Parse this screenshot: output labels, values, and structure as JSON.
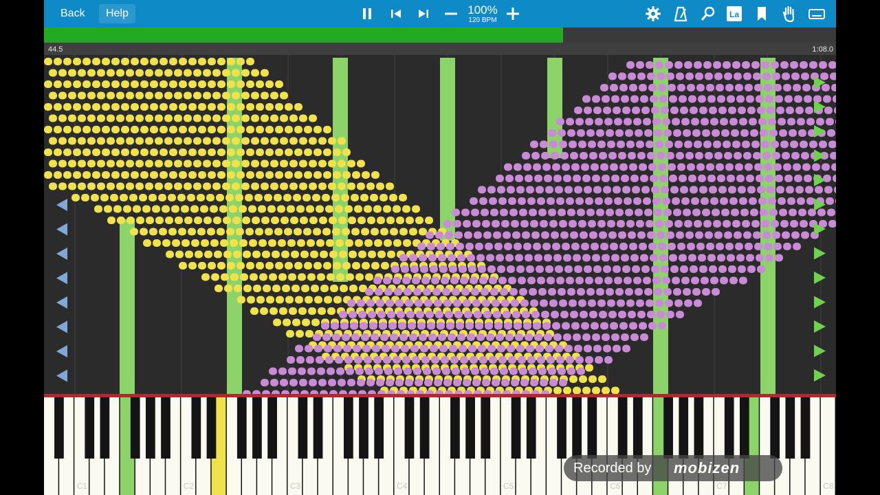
{
  "toolbar": {
    "back_label": "Back",
    "help_label": "Help",
    "zoom_percent": "100%",
    "tempo": "120 BPM",
    "icons": [
      "pause-icon",
      "skip-back-icon",
      "skip-forward-icon",
      "zoom-out-icon",
      "zoom-in-icon",
      "settings-gear-icon",
      "metronome-icon",
      "search-icon",
      "label-icon",
      "bookmark-icon",
      "hand-icon",
      "keyboard-icon"
    ]
  },
  "progress": {
    "elapsed": "44.5",
    "total": "1:08.0",
    "fraction": 0.655
  },
  "colors": {
    "toolbar": "#0e8bc7",
    "progress": "#22aa22",
    "left_hand": "#efe24a",
    "right_hand": "#c98ad6",
    "highlight": "#8cd46a"
  },
  "keyboard": {
    "octave_labels": [
      "C1",
      "C2",
      "C3",
      "C4",
      "C5",
      "C6",
      "C7",
      "C8"
    ]
  },
  "watermark": {
    "text": "Recorded by",
    "brand": "mobizen"
  }
}
